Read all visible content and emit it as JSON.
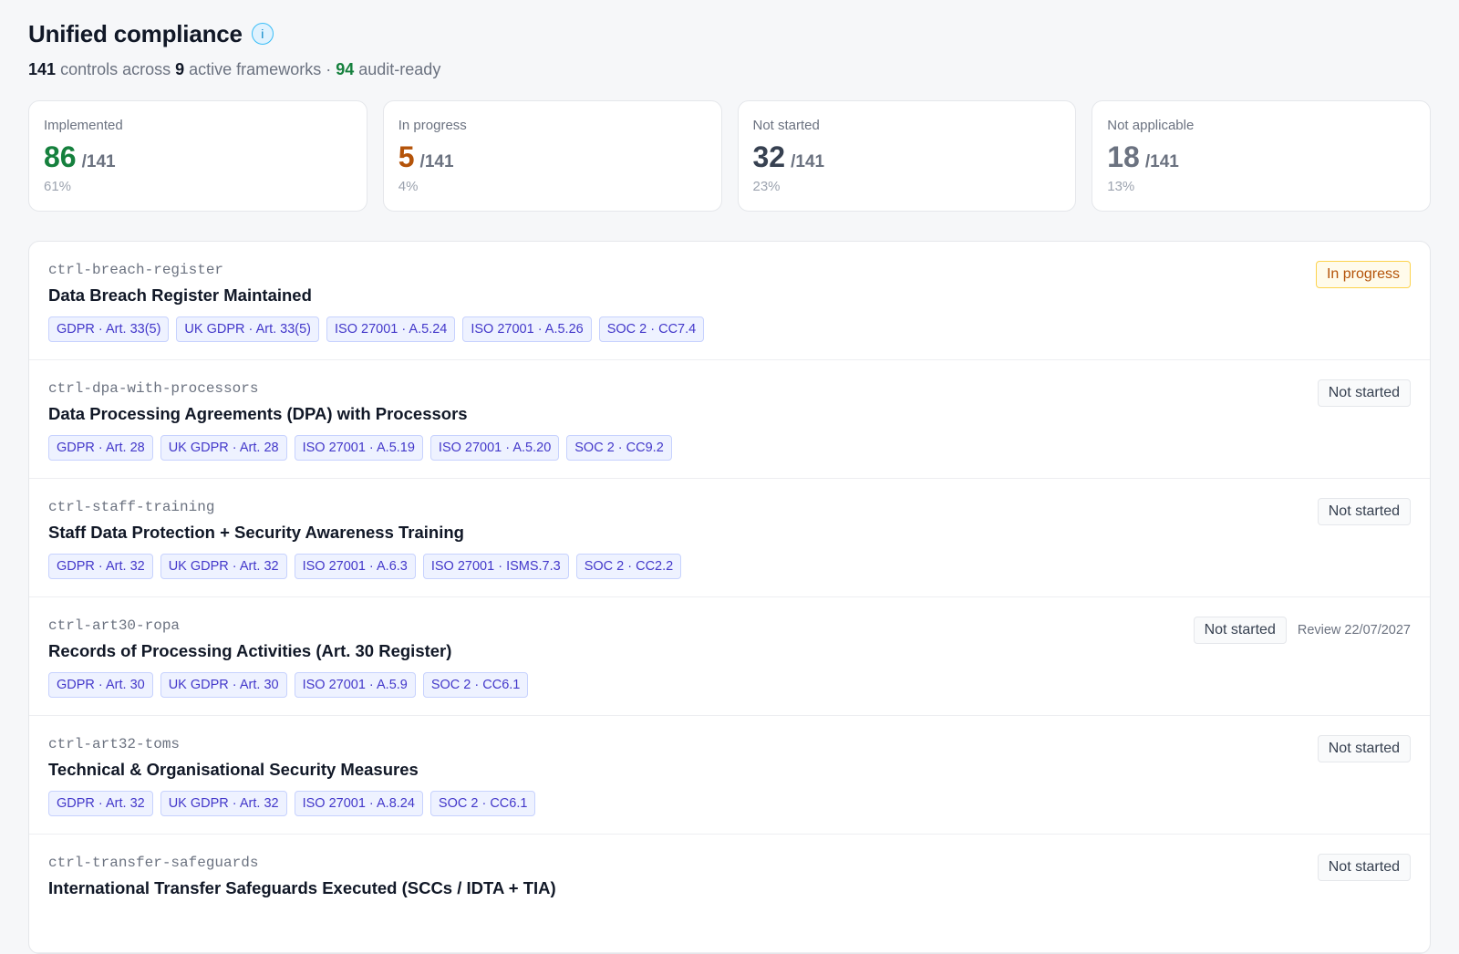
{
  "header": {
    "title": "Unified compliance",
    "info_icon": "info-icon",
    "summary": {
      "controls": "141",
      "controls_text": "controls across",
      "frameworks": "9",
      "frameworks_text": "active frameworks ·",
      "audit_ready": "94",
      "audit_ready_text": "audit-ready"
    }
  },
  "stats": [
    {
      "label": "Implemented",
      "value": "86",
      "total": "/141",
      "pct": "61%",
      "color": "#15803d"
    },
    {
      "label": "In progress",
      "value": "5",
      "total": "/141",
      "pct": "4%",
      "color": "#b45309"
    },
    {
      "label": "Not started",
      "value": "32",
      "total": "/141",
      "pct": "23%",
      "color": "#374151"
    },
    {
      "label": "Not applicable",
      "value": "18",
      "total": "/141",
      "pct": "13%",
      "color": "#6b7280"
    }
  ],
  "controls": [
    {
      "id": "ctrl-breach-register",
      "name": "Data Breach Register Maintained",
      "status": "In progress",
      "status_kind": "in-progress",
      "review": "",
      "tags": [
        "GDPR · Art. 33(5)",
        "UK GDPR · Art. 33(5)",
        "ISO 27001 · A.5.24",
        "ISO 27001 · A.5.26",
        "SOC 2 · CC7.4"
      ]
    },
    {
      "id": "ctrl-dpa-with-processors",
      "name": "Data Processing Agreements (DPA) with Processors",
      "status": "Not started",
      "status_kind": "not-started",
      "review": "",
      "tags": [
        "GDPR · Art. 28",
        "UK GDPR · Art. 28",
        "ISO 27001 · A.5.19",
        "ISO 27001 · A.5.20",
        "SOC 2 · CC9.2"
      ]
    },
    {
      "id": "ctrl-staff-training",
      "name": "Staff Data Protection + Security Awareness Training",
      "status": "Not started",
      "status_kind": "not-started",
      "review": "",
      "tags": [
        "GDPR · Art. 32",
        "UK GDPR · Art. 32",
        "ISO 27001 · A.6.3",
        "ISO 27001 · ISMS.7.3",
        "SOC 2 · CC2.2"
      ]
    },
    {
      "id": "ctrl-art30-ropa",
      "name": "Records of Processing Activities (Art. 30 Register)",
      "status": "Not started",
      "status_kind": "not-started",
      "review": "Review 22/07/2027",
      "tags": [
        "GDPR · Art. 30",
        "UK GDPR · Art. 30",
        "ISO 27001 · A.5.9",
        "SOC 2 · CC6.1"
      ]
    },
    {
      "id": "ctrl-art32-toms",
      "name": "Technical & Organisational Security Measures",
      "status": "Not started",
      "status_kind": "not-started",
      "review": "",
      "tags": [
        "GDPR · Art. 32",
        "UK GDPR · Art. 32",
        "ISO 27001 · A.8.24",
        "SOC 2 · CC6.1"
      ]
    },
    {
      "id": "ctrl-transfer-safeguards",
      "name": "International Transfer Safeguards Executed (SCCs / IDTA + TIA)",
      "status": "Not started",
      "status_kind": "not-started",
      "review": "",
      "tags": []
    }
  ]
}
